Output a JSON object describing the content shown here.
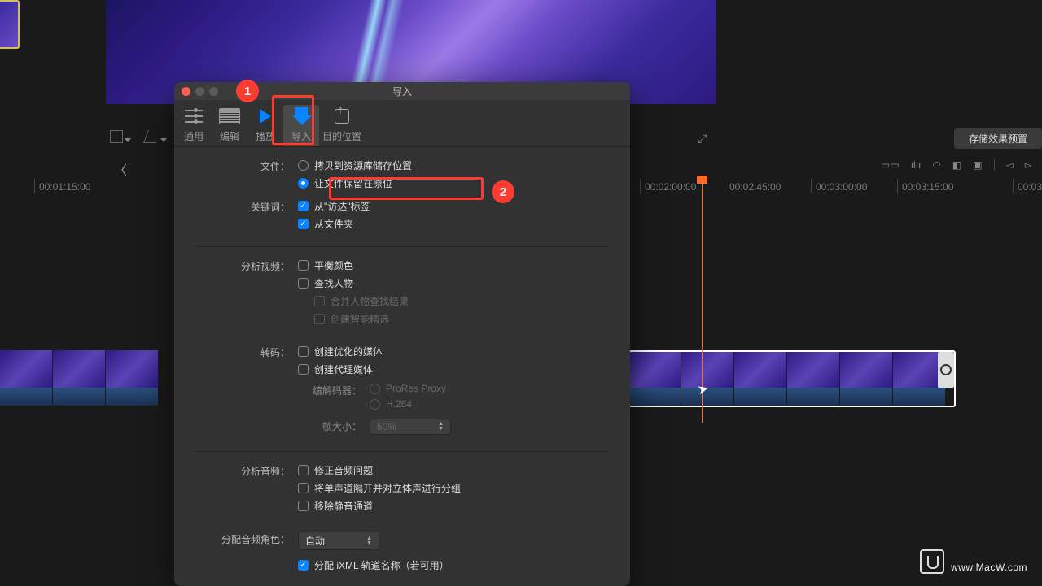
{
  "dialog": {
    "title": "导入",
    "tabs": {
      "general": "通用",
      "edit": "编辑",
      "playback": "播放",
      "import": "导入",
      "destination": "目的位置"
    },
    "file": {
      "label": "文件：",
      "copy_to_library": "拷贝到资源库储存位置",
      "leave_in_place": "让文件保留在原位"
    },
    "keywords": {
      "label": "关键词：",
      "from_finder_tags": "从\"访达\"标签",
      "from_folders": "从文件夹"
    },
    "analyze_video": {
      "label": "分析视频：",
      "balance_color": "平衡颜色",
      "find_people": "查找人物",
      "consolidate": "合并人物查找结果",
      "smart_collections": "创建智能精选"
    },
    "transcode": {
      "label": "转码：",
      "optimized": "创建优化的媒体",
      "proxy": "创建代理媒体",
      "codec_label": "编解码器：",
      "codec_prores": "ProRes Proxy",
      "codec_h264": "H.264",
      "frame_size_label": "帧大小：",
      "frame_size_value": "50%"
    },
    "analyze_audio": {
      "label": "分析音频：",
      "fix_problems": "修正音频问题",
      "separate_mono": "将单声道隔开并对立体声进行分组",
      "remove_silent": "移除静音通道"
    },
    "assign_roles": {
      "label": "分配音频角色：",
      "value": "自动",
      "ixml": "分配 iXML 轨道名称（若可用）"
    }
  },
  "timeline": {
    "ticks": [
      "00:01:15:00",
      "00:02:00:00",
      "00:02:45:00",
      "00:03:00:00",
      "00:03:15:00",
      "00:03"
    ]
  },
  "right_panel": {
    "save_preset": "存储效果预置"
  },
  "annotations": {
    "badge1": "1",
    "badge2": "2"
  },
  "watermark": "www.MacW.com"
}
